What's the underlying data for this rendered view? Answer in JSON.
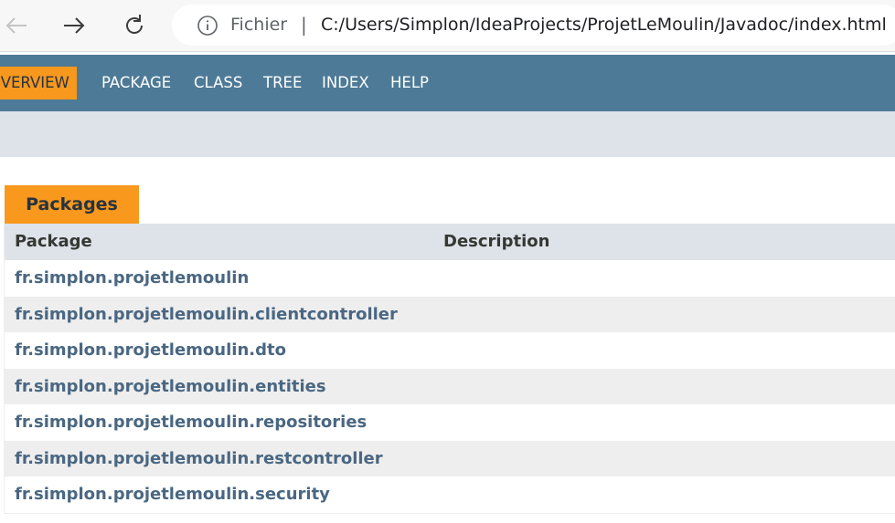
{
  "browser": {
    "back_icon": "arrow-left-icon",
    "forward_icon": "arrow-right-icon",
    "reload_icon": "reload-icon",
    "info_icon": "info-icon",
    "scheme_label": "Fichier",
    "separator": "|",
    "url": "C:/Users/Simplon/IdeaProjects/ProjetLeMoulin/Javadoc/index.html"
  },
  "nav": {
    "items": [
      {
        "label": "OVERVIEW",
        "active": true
      },
      {
        "label": "PACKAGE",
        "active": false
      },
      {
        "label": "CLASS",
        "active": false
      },
      {
        "label": "TREE",
        "active": false
      },
      {
        "label": "INDEX",
        "active": false
      },
      {
        "label": "HELP",
        "active": false
      }
    ]
  },
  "packages_table": {
    "caption": "Packages",
    "headers": {
      "package": "Package",
      "description": "Description"
    },
    "rows": [
      {
        "package": "fr.simplon.projetlemoulin",
        "description": ""
      },
      {
        "package": "fr.simplon.projetlemoulin.clientcontroller",
        "description": ""
      },
      {
        "package": "fr.simplon.projetlemoulin.dto",
        "description": ""
      },
      {
        "package": "fr.simplon.projetlemoulin.entities",
        "description": ""
      },
      {
        "package": "fr.simplon.projetlemoulin.repositories",
        "description": ""
      },
      {
        "package": "fr.simplon.projetlemoulin.restcontroller",
        "description": ""
      },
      {
        "package": "fr.simplon.projetlemoulin.security",
        "description": ""
      }
    ]
  },
  "colors": {
    "nav_background": "#4d7a97",
    "active_tab": "#f8981d",
    "subnav_background": "#dee3e9",
    "link": "#4a6782",
    "row_alt": "#eeeeee"
  }
}
